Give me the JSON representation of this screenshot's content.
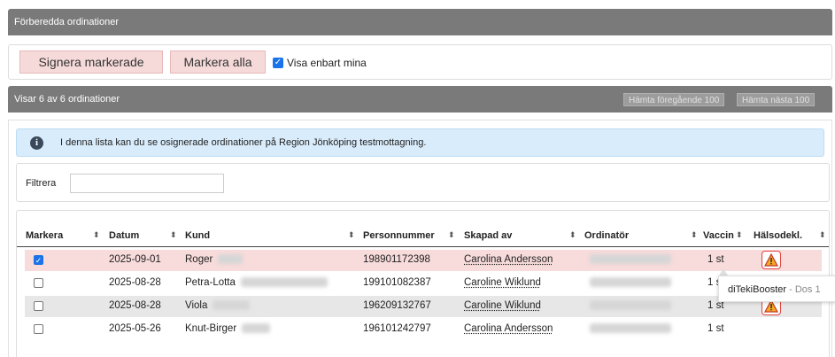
{
  "header": {
    "title": "Förberedda ordinationer"
  },
  "toolbar": {
    "sign_label": "Signera markerade",
    "select_all_label": "Markera alla",
    "only_mine_label": "Visa enbart mina",
    "only_mine_checked": true
  },
  "status": {
    "showing_text": "Visar 6 av 6 ordinationer",
    "prev_label": "Hämta föregående 100",
    "next_label": "Hämta nästa 100"
  },
  "info": {
    "message": "I denna lista kan du se osignerade ordinationer på Region Jönköping testmottagning."
  },
  "filter": {
    "label": "Filtrera",
    "value": ""
  },
  "table": {
    "columns": [
      "Markera",
      "Datum",
      "Kund",
      "Personnummer",
      "Skapad av",
      "Ordinatör",
      "Vaccin",
      "Hälsodekl."
    ],
    "rows": [
      {
        "checked": true,
        "date": "2025-09-01",
        "customer": "Roger",
        "pnr": "198901172398",
        "created_by": "Carolina Andersson",
        "vaccine": "1 st",
        "warning": true
      },
      {
        "checked": false,
        "date": "2025-08-28",
        "customer": "Petra-Lotta",
        "pnr": "199101082387",
        "created_by": "Caroline Wiklund",
        "vaccine": "1 st",
        "warning": false
      },
      {
        "checked": false,
        "date": "2025-08-28",
        "customer": "Viola",
        "pnr": "196209132767",
        "created_by": "Caroline Wiklund",
        "vaccine": "1 st",
        "warning": true
      },
      {
        "checked": false,
        "date": "2025-05-26",
        "customer": "Knut-Birger",
        "pnr": "196101242797",
        "created_by": "Carolina Andersson",
        "vaccine": "1 st",
        "warning": false
      }
    ]
  },
  "tooltip": {
    "vaccine_name": "diTekiBooster",
    "dose": "- Dos 1"
  },
  "colors": {
    "header_bg": "#7a7a7a",
    "button_bg": "#f6dada",
    "selected_row": "#f8dbdb",
    "info_bg": "#d9ecfb",
    "warning": "#e0443c",
    "checkbox": "#1a73e8"
  },
  "icons": {
    "info": "info-icon",
    "warning": "warning-triangle-icon",
    "sort": "sort-icon",
    "check": "check-icon"
  }
}
